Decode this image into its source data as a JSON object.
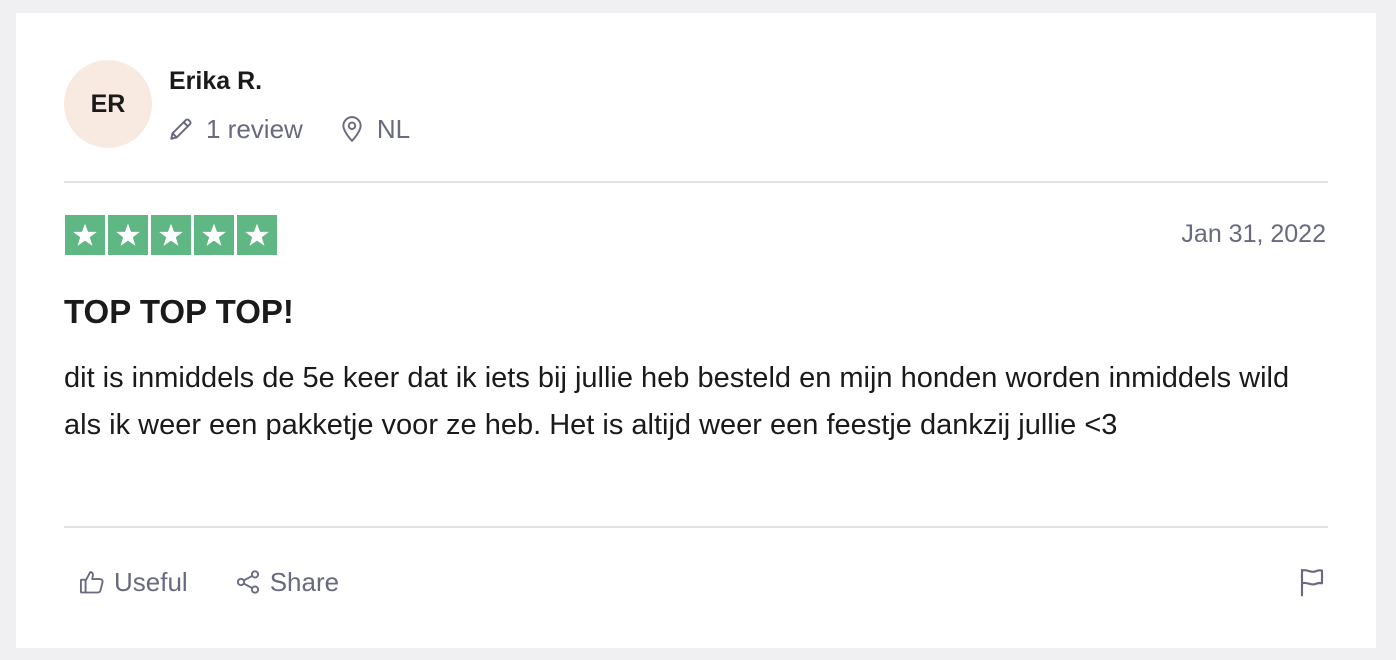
{
  "reviewer": {
    "initials": "ER",
    "name": "Erika R.",
    "review_count": "1 review",
    "country": "NL",
    "avatar_color": "#f9eae1"
  },
  "review": {
    "rating": 5,
    "max_rating": 5,
    "star_color": "#5fb784",
    "date": "Jan 31, 2022",
    "title": "TOP TOP TOP!",
    "text": "dit is inmiddels de 5e keer dat ik iets bij jullie heb besteld en mijn honden worden inmiddels wild als ik weer een pakketje voor ze heb. Het is altijd weer een feestje dankzij jullie <3"
  },
  "actions": {
    "useful_label": "Useful",
    "share_label": "Share"
  },
  "icons": {
    "reviews": "pencil-icon",
    "location": "location-pin-icon",
    "useful": "thumbs-up-icon",
    "share": "share-icon",
    "report": "flag-icon",
    "star": "star-icon"
  }
}
